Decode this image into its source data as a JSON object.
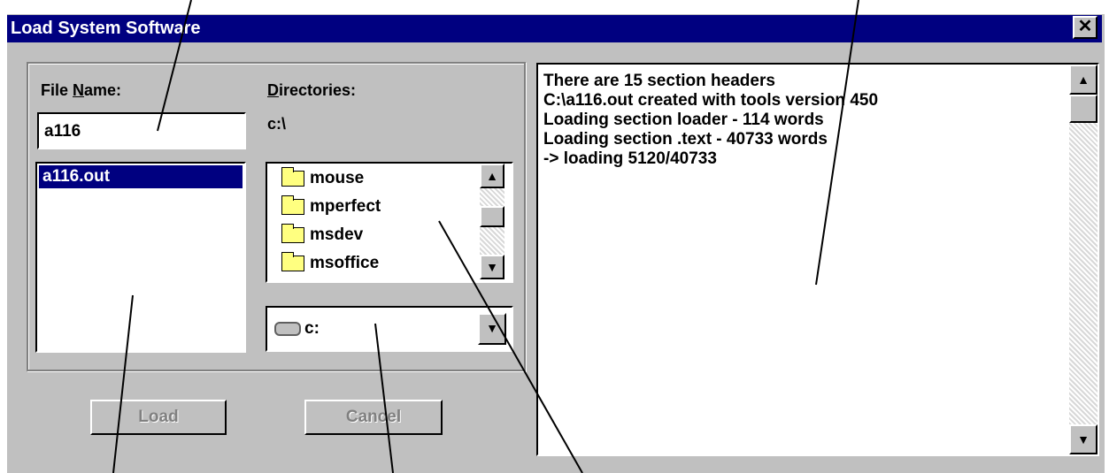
{
  "window": {
    "title": "Load System Software",
    "close_glyph": "✕"
  },
  "file_name": {
    "label_prefix": "File ",
    "label_underlined": "N",
    "label_suffix": "ame:",
    "value": "a116"
  },
  "file_list": {
    "items": [
      "a116.out"
    ],
    "selected": "a116.out"
  },
  "directories": {
    "label_underlined": "D",
    "label_suffix": "irectories:",
    "current_path": "c:\\",
    "items": [
      "mouse",
      "mperfect",
      "msdev",
      "msoffice"
    ]
  },
  "drive": {
    "value": "c:"
  },
  "buttons": {
    "load": "Load",
    "cancel": "Cancel"
  },
  "log": {
    "lines": [
      "There are 15 section headers",
      "C:\\a116.out created with tools version 450",
      "Loading section loader - 114 words",
      "Loading section .text - 40733 words",
      "-> loading 5120/40733"
    ]
  },
  "icons": {
    "scroll_up": "▲",
    "scroll_down": "▼",
    "dropdown": "▼"
  }
}
